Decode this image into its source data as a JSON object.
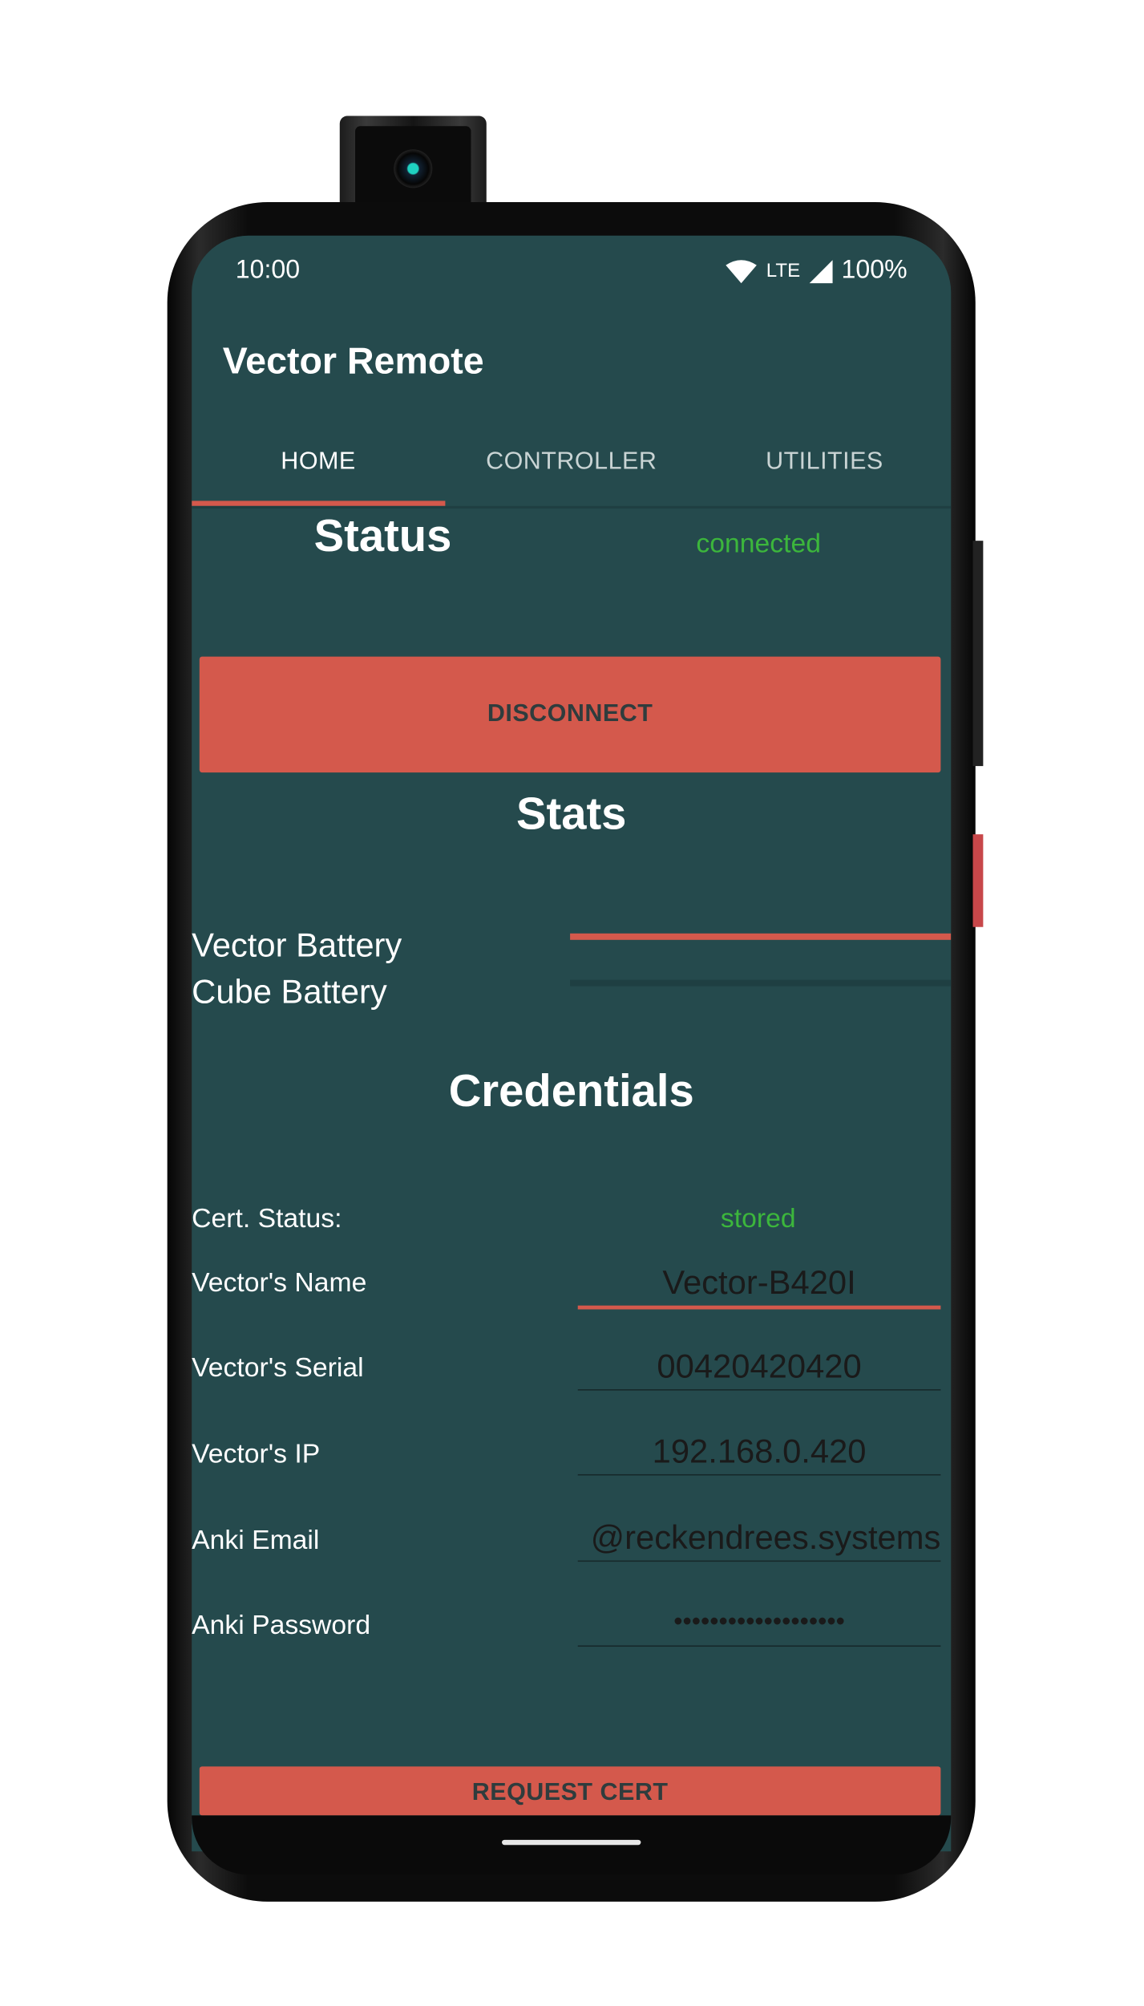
{
  "status_bar": {
    "time": "10:00",
    "network": "LTE",
    "battery": "100%"
  },
  "app": {
    "title": "Vector Remote"
  },
  "tabs": [
    {
      "label": "HOME",
      "active": true
    },
    {
      "label": "CONTROLLER",
      "active": false
    },
    {
      "label": "UTILITIES",
      "active": false
    }
  ],
  "status": {
    "label": "Status",
    "value": "connected"
  },
  "disconnect_button": "DISCONNECT",
  "stats": {
    "title": "Stats",
    "vector_battery_label": "Vector Battery",
    "cube_battery_label": "Cube Battery",
    "vector_battery_level": 1.0,
    "cube_battery_level": 0.0
  },
  "credentials": {
    "title": "Credentials",
    "cert_status_label": "Cert. Status:",
    "cert_status_value": "stored",
    "fields": [
      {
        "label": "Vector's Name",
        "value": "Vector-B420I"
      },
      {
        "label": "Vector's Serial",
        "value": "00420420420"
      },
      {
        "label": "Vector's IP",
        "value": "192.168.0.420"
      },
      {
        "label": "Anki Email",
        "value": "@reckendrees.systems"
      },
      {
        "label": "Anki Password",
        "value": "•••••••••••••••••••"
      }
    ]
  },
  "request_cert_button": "REQUEST CERT",
  "colors": {
    "background": "#254a4d",
    "accent": "#d4594c",
    "status_ok": "#3cb63c"
  }
}
